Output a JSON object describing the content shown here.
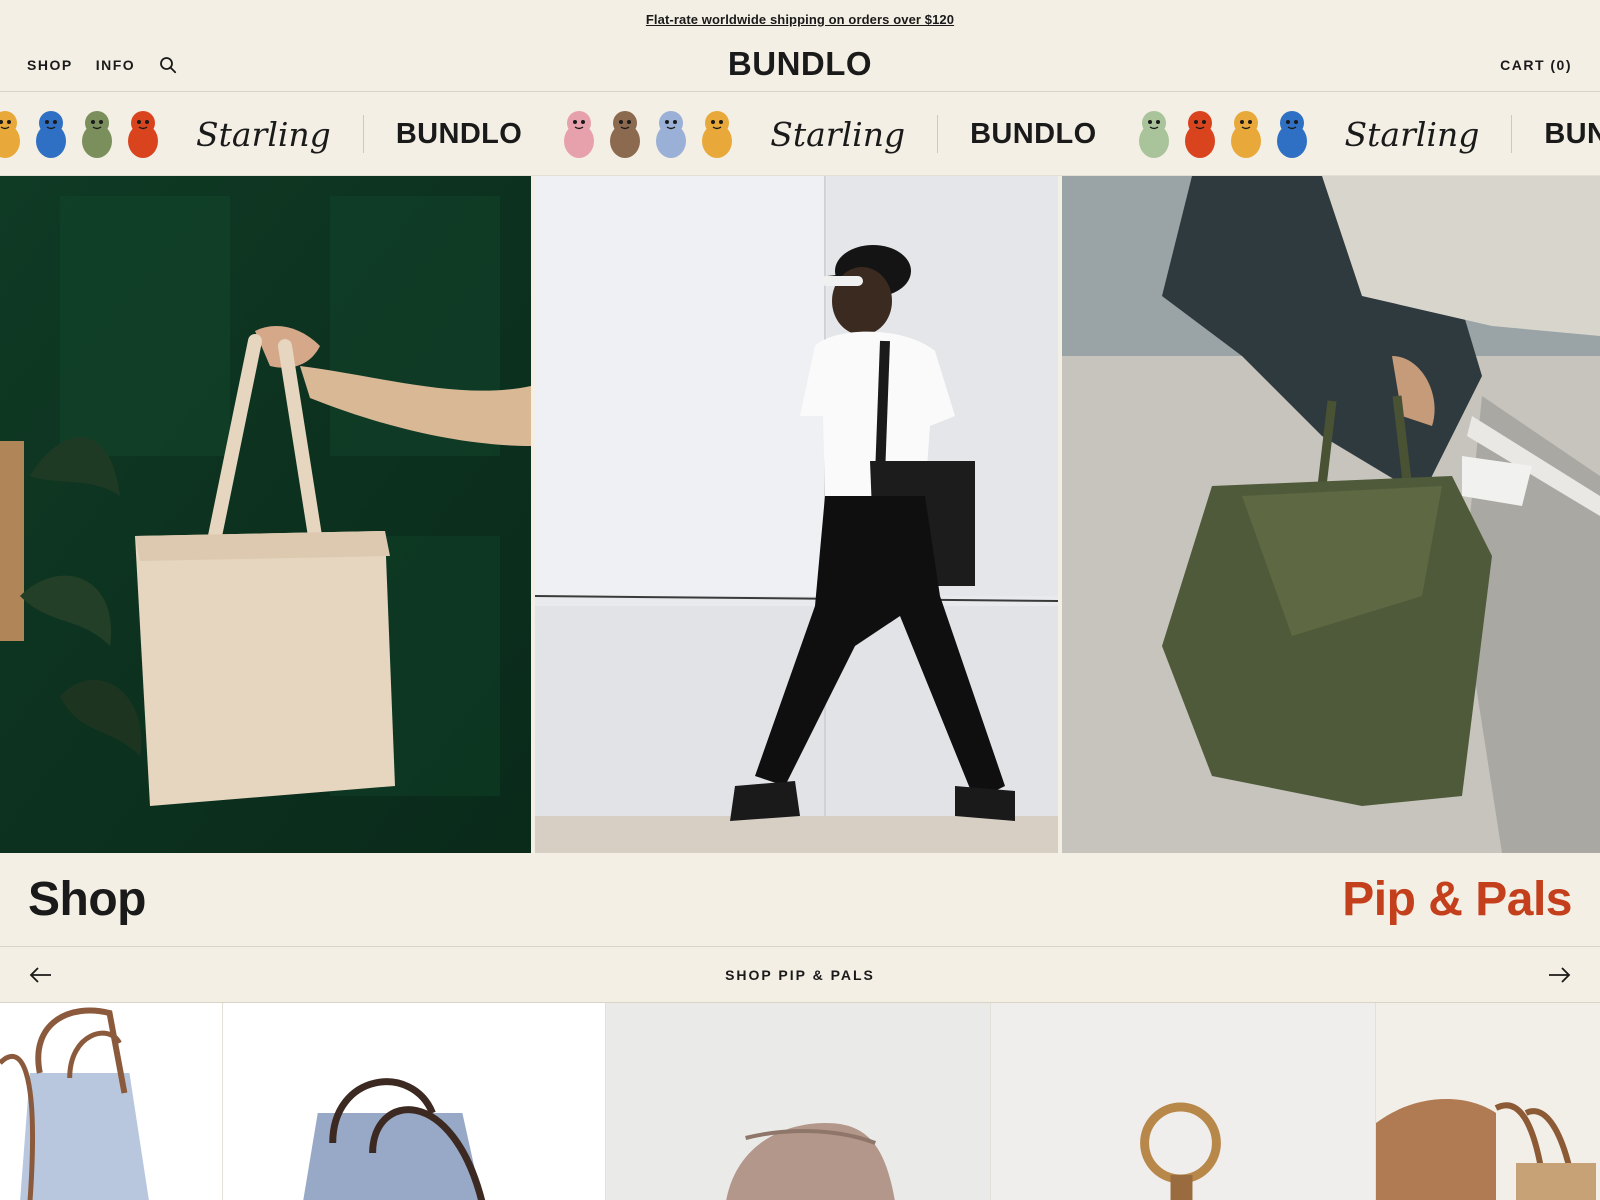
{
  "announcement": {
    "text": "Flat-rate worldwide shipping on orders over $120"
  },
  "header": {
    "nav": [
      {
        "label": "SHOP"
      },
      {
        "label": "INFO"
      }
    ],
    "logo": "BUNDLO",
    "cart_label": "CART (0)",
    "search_icon": "search-icon"
  },
  "marquee": {
    "script_word": "Starling",
    "brand_word": "BUNDLO",
    "pal_icon": "pal-character-icon",
    "groups": [
      {
        "pal_colors": [
          "#e8a93a",
          "#2f6fc4",
          "#7a8f5c",
          "#d9441f"
        ]
      },
      {
        "pal_colors": [
          "#e7a1ad",
          "#8c6a4f",
          "#9bb0d6",
          "#e8a93a"
        ]
      },
      {
        "pal_colors": [
          "#a9c49a",
          "#d9441f",
          "#e8a93a",
          "#2f6fc4"
        ]
      }
    ]
  },
  "hero": {
    "images": [
      {
        "alt": "Hand holding a natural canvas tote bag against a green door"
      },
      {
        "alt": "Man in white tee and cap walking with a black tote bag"
      },
      {
        "alt": "Person carrying an olive green tote bag by a wall"
      }
    ]
  },
  "shop_section": {
    "title": "Shop",
    "collection_title": "Pip & Pals",
    "carousel_label": "SHOP PIP & PALS",
    "prev_icon": "arrow-left-icon",
    "next_icon": "arrow-right-icon"
  },
  "products": [
    {
      "alt": "Light blue tote with brown leather handles"
    },
    {
      "alt": "Blue tote with brown straps"
    },
    {
      "alt": "Taupe drawstring pouch"
    },
    {
      "alt": "Brass key ring with engraved text"
    },
    {
      "alt": "Hand holding a tan tote bag"
    }
  ],
  "colors": {
    "background": "#f3efe4",
    "text": "#1a1a1a",
    "accent": "#c4401c",
    "divider": "#d9d4c6"
  }
}
